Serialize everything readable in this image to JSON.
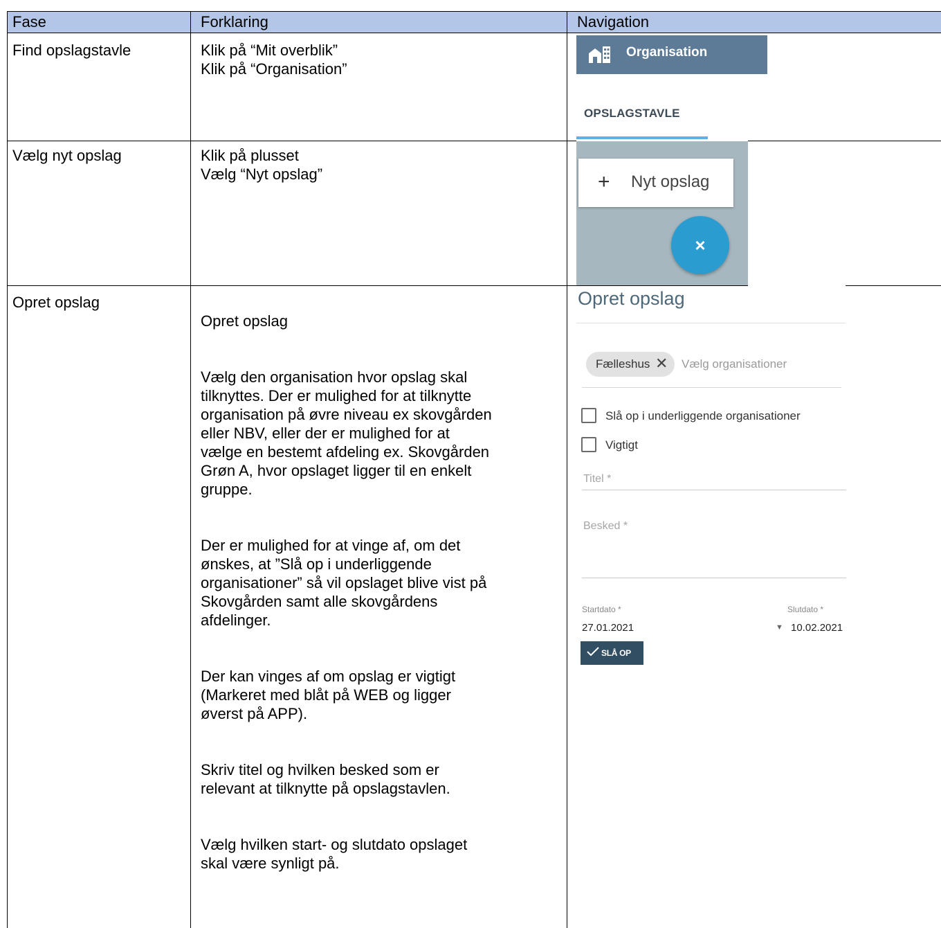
{
  "table": {
    "headers": [
      "Fase",
      "Forklaring",
      "Navigation"
    ],
    "rows": [
      {
        "fase": "Find opslagstavle",
        "forklaring": [
          "Klik på “Mit overblik”\nKlik på “Organisation”"
        ]
      },
      {
        "fase": "Vælg nyt opslag",
        "forklaring": [
          "Klik på plusset\nVælg “Nyt opslag”"
        ]
      },
      {
        "fase": "Opret opslag",
        "forklaring": [
          "Opret opslag",
          "Vælg den organisation hvor opslag skal\ntilknyttes. Der er mulighed for at tilknytte\norganisation på øvre niveau ex skovgården\neller NBV, eller der er mulighed for at\nvælge en bestemt afdeling ex. Skovgården\nGrøn A, hvor opslaget ligger til en enkelt\ngruppe.",
          "Der er mulighed for at vinge af, om det\nønskes, at ”Slå op i underliggende\norganisationer” så vil opslaget blive vist på\nSkovgården samt alle skovgårdens\nafdelinger.",
          "Der kan vinges af om opslag er vigtigt\n(Markeret med blåt på WEB og ligger\nøverst på APP).",
          "Skriv titel og hvilken besked som er\nrelevant at tilknytte på opslagstavlen.",
          "Vælg hvilken start- og slutdato opslaget\nskal være synligt på."
        ]
      }
    ]
  },
  "nav1": {
    "org_label": "Organisation",
    "tab_label": "OPSLAGSTAVLE"
  },
  "nav2": {
    "plus_glyph": "+",
    "menu_label": "Nyt opslag",
    "close_glyph": "×"
  },
  "form": {
    "title": "Opret opslag",
    "chip_label": "Fælleshus",
    "chip_remove_glyph": "✕",
    "org_placeholder": "Vælg organisationer",
    "checkbox_sub": "Slå op i underliggende organisationer",
    "checkbox_important": "Vigtigt",
    "title_label": "Titel *",
    "message_label": "Besked *",
    "start_label": "Startdato *",
    "start_value": "27.01.2021",
    "end_label": "Slutdato *",
    "end_value": "10.02.2021",
    "caret_glyph": "▼",
    "submit_label": "SLÅ OP"
  },
  "colors": {
    "header_bg": "#b4c6e7",
    "org_bar": "#5d7b96",
    "fab": "#2b9cd0",
    "submit": "#324e63",
    "tab_underline": "#5fb1df"
  }
}
